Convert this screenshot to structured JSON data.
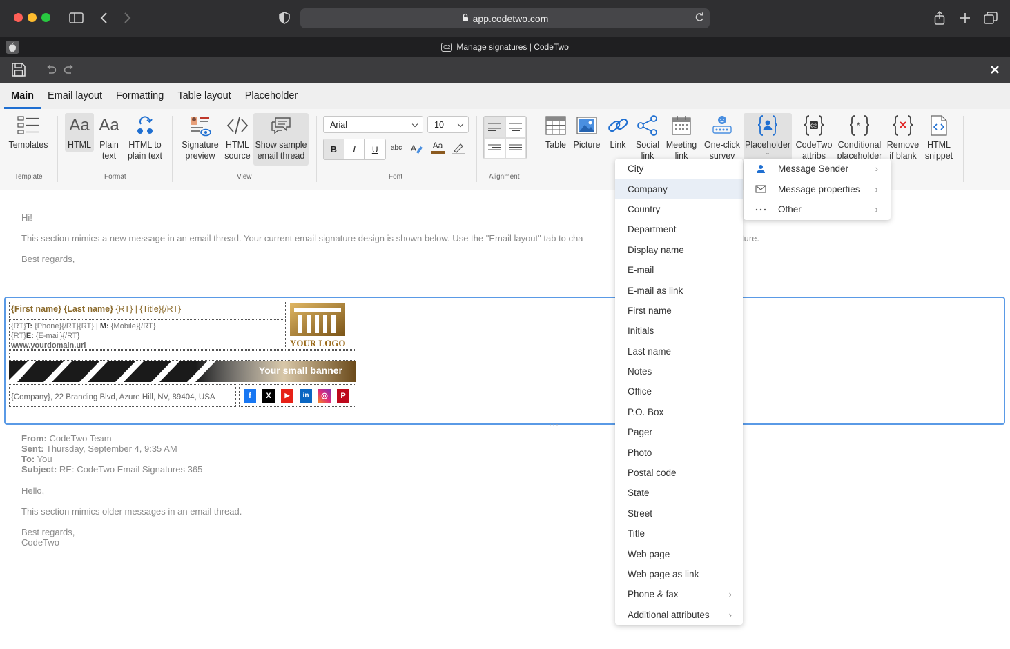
{
  "browser": {
    "url": "app.codetwo.com",
    "tab_title": "Manage signatures | CodeTwo",
    "tab_badge": "C2"
  },
  "ribbon_tabs": [
    "Main",
    "Email layout",
    "Formatting",
    "Table layout",
    "Placeholder"
  ],
  "ribbon": {
    "templates_label": "Templates",
    "html_label": "HTML",
    "plain_text_label": "Plain text",
    "html_to_plain_label": "HTML to plain text",
    "signature_preview_label": "Signature preview",
    "html_source_label": "HTML source",
    "show_sample_label": "Show sample email thread",
    "font_family": "Arial",
    "font_size": "10",
    "table_label": "Table",
    "picture_label": "Picture",
    "link_label": "Link",
    "social_link_label": "Social link",
    "meeting_link_label": "Meeting link",
    "one_click_survey_label": "One-click survey",
    "placeholder_label": "Placeholder",
    "codetwo_attribs_label": "CodeTwo attribs",
    "conditional_placeholder_label": "Conditional placeholder",
    "remove_if_blank_label": "Remove if blank",
    "html_snippet_label": "HTML snippet",
    "aa_glyph": "Aa",
    "group_template": "Template",
    "group_format": "Format",
    "group_view": "View",
    "group_font": "Font",
    "group_alignment": "Alignment",
    "bold": "B",
    "italic": "I",
    "underline": "U",
    "strikethrough": "abc",
    "font_color_glyph": "Aa"
  },
  "email": {
    "greeting": "Hi!",
    "intro": "This section mimics a new message in an email thread. Your current email signature design is shown below. Use the \"Email layout\" tab to cha",
    "intro_tail": "ture.",
    "closing": "Best regards,",
    "from_label": "From:",
    "from_value": " CodeTwo Team",
    "sent_label": "Sent:",
    "sent_value": " Thursday, September 4, 9:35 AM",
    "to_label": "To:",
    "to_value": " You",
    "subject_label": "Subject:",
    "subject_value": " RE: CodeTwo Email Signatures 365",
    "hello": "Hello,",
    "older": "This section mimics older messages in an email thread.",
    "closing2": "Best regards,",
    "closing2_name": "CodeTwo",
    "resize_handle": "···"
  },
  "signature": {
    "name_line_bold": "{First name} {Last name}",
    "name_line_rest": " {RT} | {Title}{/RT}",
    "phone_prefix": "{RT}",
    "phone_t": "T:",
    "phone_value": " {Phone}{/RT}{RT} | ",
    "mobile_m": "M:",
    "mobile_value": " {Mobile}{/RT}",
    "email_prefix": "{RT}",
    "email_e": "E:",
    "email_value": " {E-mail}{/RT}",
    "website": "www.yourdomain.url",
    "logo_text": "YOUR LOGO",
    "banner_text": "Your small banner",
    "address": "{Company}, 22 Branding Blvd, Azure Hill, NV, 89404, USA",
    "social": [
      "f",
      "X",
      "▶",
      "in",
      "◎",
      "P"
    ]
  },
  "placeholder_menu": {
    "items": [
      {
        "label": "City"
      },
      {
        "label": "Company",
        "highlighted": true
      },
      {
        "label": "Country"
      },
      {
        "label": "Department"
      },
      {
        "label": "Display name"
      },
      {
        "label": "E-mail"
      },
      {
        "label": "E-mail as link"
      },
      {
        "label": "First name"
      },
      {
        "label": "Initials"
      },
      {
        "label": "Last name"
      },
      {
        "label": "Notes"
      },
      {
        "label": "Office"
      },
      {
        "label": "P.O. Box"
      },
      {
        "label": "Pager"
      },
      {
        "label": "Photo"
      },
      {
        "label": "Postal code"
      },
      {
        "label": "State"
      },
      {
        "label": "Street"
      },
      {
        "label": "Title"
      },
      {
        "label": "Web page"
      },
      {
        "label": "Web page as link"
      },
      {
        "label": "Phone & fax",
        "submenu": true
      },
      {
        "label": "Additional attributes",
        "submenu": true
      }
    ]
  },
  "submenu": {
    "items": [
      {
        "label": "Message Sender",
        "icon": "person-icon"
      },
      {
        "label": "Message properties",
        "icon": "envelope-icon"
      },
      {
        "label": "Other",
        "icon": "more-icon"
      }
    ]
  },
  "colors": {
    "accent": "#1f6fd1",
    "signature_brown": "#8b6a2b",
    "frame_blue": "#5a9ae6"
  }
}
